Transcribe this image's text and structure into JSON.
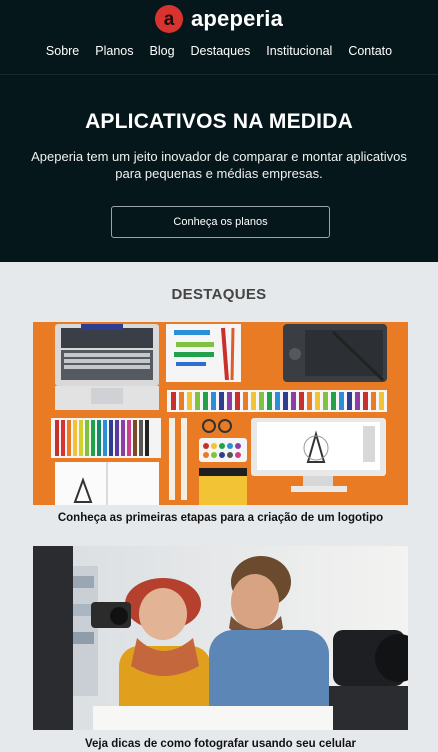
{
  "brand": {
    "name": "apeperia",
    "logo_letter": "a",
    "logo_color": "#d9332f"
  },
  "nav": {
    "items": [
      {
        "label": "Sobre"
      },
      {
        "label": "Planos"
      },
      {
        "label": "Blog"
      },
      {
        "label": "Destaques"
      },
      {
        "label": "Institucional"
      },
      {
        "label": "Contato"
      }
    ]
  },
  "hero": {
    "title": "APLICATIVOS NA MEDIDA",
    "subtitle": "Apeperia tem um jeito inovador de comparar e montar aplicativos para pequenas e médias empresas.",
    "button_label": "Conheça os planos",
    "background": "#06171b"
  },
  "highlights": {
    "title": "DESTAQUES",
    "items": [
      {
        "caption": "Conheça as primeiras etapas para a criação de um logotipo"
      },
      {
        "caption": "Veja dicas de como fotografar usando seu celular"
      }
    ]
  }
}
